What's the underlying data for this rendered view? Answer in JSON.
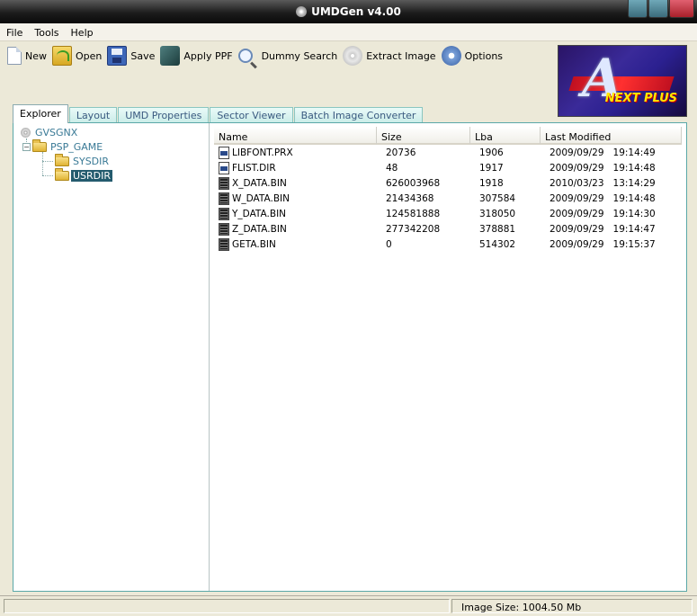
{
  "window": {
    "title": "UMDGen v4.00"
  },
  "menu": [
    "File",
    "Tools",
    "Help"
  ],
  "toolbar": {
    "new": "New",
    "open": "Open",
    "save": "Save",
    "apply_ppf": "Apply PPF",
    "dummy_search": "Dummy Search",
    "extract_image": "Extract Image",
    "options": "Options"
  },
  "tabs": [
    "Explorer",
    "Layout",
    "UMD Properties",
    "Sector Viewer",
    "Batch Image Converter"
  ],
  "tree": {
    "root": "GVSGNX",
    "psp_game": "PSP_GAME",
    "sysdir": "SYSDIR",
    "usrdir": "USRDIR"
  },
  "columns": [
    "Name",
    "Size",
    "Lba",
    "Last Modified"
  ],
  "files": [
    {
      "name": "LIBFONT.PRX",
      "size": "20736",
      "lba": "1906",
      "modified": "2009/09/29   19:14:49",
      "icon": "doc"
    },
    {
      "name": "FLIST.DIR",
      "size": "48",
      "lba": "1917",
      "modified": "2009/09/29   19:14:48",
      "icon": "doc"
    },
    {
      "name": "X_DATA.BIN",
      "size": "626003968",
      "lba": "1918",
      "modified": "2010/03/23   13:14:29",
      "icon": "bin"
    },
    {
      "name": "W_DATA.BIN",
      "size": "21434368",
      "lba": "307584",
      "modified": "2009/09/29   19:14:48",
      "icon": "bin"
    },
    {
      "name": "Y_DATA.BIN",
      "size": "124581888",
      "lba": "318050",
      "modified": "2009/09/29   19:14:30",
      "icon": "bin"
    },
    {
      "name": "Z_DATA.BIN",
      "size": "277342208",
      "lba": "378881",
      "modified": "2009/09/29   19:14:47",
      "icon": "bin"
    },
    {
      "name": "GETA.BIN",
      "size": "0",
      "lba": "514302",
      "modified": "2009/09/29   19:15:37",
      "icon": "bin"
    }
  ],
  "status": {
    "image_size": "Image Size: 1004.50 Mb"
  },
  "logo": {
    "text": "NEXT PLUS"
  }
}
